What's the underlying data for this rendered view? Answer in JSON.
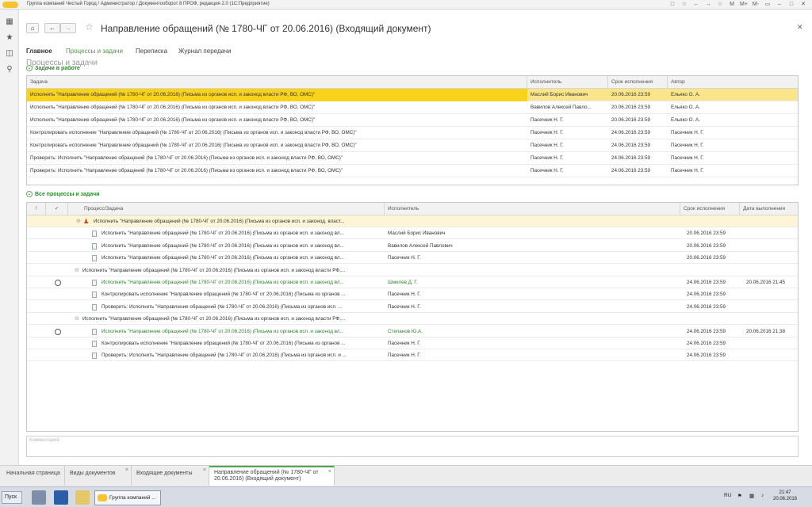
{
  "window": {
    "title": "Группа компаний Чистый Город / Администратор / Документооборот 8 ПРОФ, редакция 2.0  (1С:Предприятие)",
    "controls": [
      "□",
      "☆",
      "←",
      "→",
      "☆",
      "M",
      "M+",
      "M-",
      "▭",
      "–",
      "□",
      "✕"
    ]
  },
  "sidebar": {
    "icons": [
      "apps-icon",
      "star-icon",
      "history-icon",
      "search-icon"
    ]
  },
  "document": {
    "title": "Направление обращений (№ 1780-ЧГ от 20.06.2016) (Входящий документ)"
  },
  "tabs": {
    "main": "Главное",
    "processes": "Процессы и задачи",
    "correspondence": "Переписка",
    "log": "Журнал передачи"
  },
  "section_title": "Процессы и задачи",
  "tasks_in_work": {
    "group_label": "Задачи в работе",
    "columns": [
      "Задача",
      "Исполнитель",
      "Срок исполнения",
      "Автор"
    ],
    "rows": [
      {
        "task": "Исполнить \"Направление обращений (№ 1780-ЧГ от 20.06.2016) (Письма из органов исп. и законод власти РФ, ВО, ОМС)\"",
        "executor": "Маслий Борис Иванович",
        "due": "20.06.2016 23:59",
        "author": "Ельяко О. А."
      },
      {
        "task": "Исполнить \"Направление обращений (№ 1780-ЧГ от 20.06.2016) (Письма из органов исп. и законод власти РФ, ВО, ОМС)\"",
        "executor": "Вавилов Алексей Павло...",
        "due": "20.06.2016 23:59",
        "author": "Ельяко О. А."
      },
      {
        "task": "Исполнить \"Направление обращений (№ 1780-ЧГ от 20.06.2016) (Письма из органов исп. и законод власти РФ, ВО, ОМС)\"",
        "executor": "Пасечник Н. Г.",
        "due": "20.06.2016 23:59",
        "author": "Ельяко О. А."
      },
      {
        "task": "Контролировать исполнение \"Направление обращений (№ 1780-ЧГ от 20.06.2016) (Письма из органов исп. и законод власти РФ, ВО, ОМС)\"",
        "executor": "Пасечник Н. Г.",
        "due": "24.06.2016 23:59",
        "author": "Пасечник Н. Г."
      },
      {
        "task": "Контролировать исполнение \"Направление обращений (№ 1780-ЧГ от 20.06.2016) (Письма из органов исп. и законод власти РФ, ВО, ОМС)\"",
        "executor": "Пасечник Н. Г.",
        "due": "24.06.2016 23:59",
        "author": "Пасечник Н. Г."
      },
      {
        "task": "Проверить: Исполнить \"Направление обращений (№ 1780-ЧГ от 20.06.2016) (Письма из органов исп. и законод власти РФ, ВО, ОМС)\"",
        "executor": "Пасечник Н. Г.",
        "due": "24.06.2016 23:59",
        "author": "Пасечник Н. Г."
      },
      {
        "task": "Проверить: Исполнить \"Направление обращений (№ 1780-ЧГ от 20.06.2016) (Письма из органов исп. и законод власти РФ, ВО, ОМС)\"",
        "executor": "Пасечник Н. Г.",
        "due": "24.06.2016 23:59",
        "author": "Пасечник Н. Г."
      }
    ]
  },
  "all_processes": {
    "group_label": "Все процессы и задачи",
    "columns": [
      "!",
      "✓",
      "Процесс/Задача",
      "Исполнитель",
      "Срок исполнения",
      "Дата выполнения"
    ],
    "rows": [
      {
        "level": 1,
        "icon": "user",
        "text": "Исполнить \"Направление обращений (№ 1780-ЧГ от 20.06.2016) (Письма из органов исп. и законод. власт...",
        "executor": "",
        "due": "",
        "done_date": "",
        "check": false
      },
      {
        "level": 2,
        "icon": "doc",
        "text": "Исполнить \"Направление обращений (№ 1780-ЧГ от 20.06.2016) (Письма из органов исп. и законод вл...",
        "executor": "Маслий Борис Иванович",
        "due": "20.06.2016 23:59",
        "done_date": "",
        "check": false
      },
      {
        "level": 2,
        "icon": "doc",
        "text": "Исполнить \"Направление обращений (№ 1780-ЧГ от 20.06.2016) (Письма из органов исп. и законод вл...",
        "executor": "Вавилов Алексей Павлович",
        "due": "20.06.2016 23:59",
        "done_date": "",
        "check": false
      },
      {
        "level": 2,
        "icon": "doc",
        "text": "Исполнить \"Направление обращений (№ 1780-ЧГ от 20.06.2016) (Письма из органов исп. и законод вл...",
        "executor": "Пасечник Н. Г.",
        "due": "20.06.2016 23:59",
        "done_date": "",
        "check": false
      },
      {
        "level": 0,
        "icon": "none",
        "text": "Исполнить \"Направление обращений (№ 1780-ЧГ от 20.06.2016) (Письма из органов исп. и законод власти РФ,...",
        "executor": "",
        "due": "",
        "done_date": "",
        "check": false
      },
      {
        "level": 2,
        "icon": "doc",
        "text": "Исполнить \"Направление обращений (№ 1780-ЧГ от 20.06.2016) (Письма из органов исп. и законод вл...",
        "executor": "Шмелев Д. Г.",
        "due": "24.06.2016 23:59",
        "done_date": "20.06.2016 21:45",
        "check": true,
        "green": true
      },
      {
        "level": 2,
        "icon": "doc",
        "text": "Контролировать исполнение \"Направление обращений (№ 1780-ЧГ от 20.06.2016) (Письма из органов ...",
        "executor": "Пасечник Н. Г.",
        "due": "24.06.2016 23:59",
        "done_date": "",
        "check": false
      },
      {
        "level": 2,
        "icon": "doc",
        "text": "Проверить: Исполнить \"Направление обращений (№ 1780-ЧГ от 20.06.2016) (Письма из органов исп. ...",
        "executor": "Пасечник Н. Г.",
        "due": "24.06.2016 23:59",
        "done_date": "",
        "check": false
      },
      {
        "level": 0,
        "icon": "none",
        "text": "Исполнить \"Направление обращений (№ 1780-ЧГ от 20.06.2016) (Письма из органов исп. и законод власти РФ,...",
        "executor": "",
        "due": "",
        "done_date": "",
        "check": false
      },
      {
        "level": 2,
        "icon": "doc",
        "text": "Исполнить \"Направление обращений (№ 1780-ЧГ от 20.06.2016) (Письма из органов исп. и законод вл...",
        "executor": "Степанов Ю.А.",
        "due": "24.06.2016 23:59",
        "done_date": "20.06.2016 21:38",
        "check": true,
        "green": true
      },
      {
        "level": 2,
        "icon": "doc",
        "text": "Контролировать исполнение \"Направление обращений (№ 1780-ЧГ от 20.06.2016) (Письма из органов ...",
        "executor": "Пасечник Н. Г.",
        "due": "24.06.2016 23:59",
        "done_date": "",
        "check": false
      },
      {
        "level": 2,
        "icon": "doc",
        "text": "Проверить: Исполнить \"Направление обращений (№ 1780-ЧГ от 20.06.2016) (Письма из органов исп. и ...",
        "executor": "Пасечник Н. Г.",
        "due": "24.06.2016 23:59",
        "done_date": "",
        "check": false
      }
    ]
  },
  "comment": {
    "placeholder": "Комментарий"
  },
  "bottom_tabs": [
    {
      "label": "Начальная страница",
      "closable": false
    },
    {
      "label": "Виды документов",
      "closable": true
    },
    {
      "label": "Входящие документы",
      "closable": true
    },
    {
      "label": "Направление обращений (№ 1780-ЧГ от 20.06.2016) (Входящий документ)",
      "closable": true,
      "active": true
    }
  ],
  "taskbar": {
    "start": "Пуск",
    "app_label": "Группа компаний ...",
    "lang": "RU",
    "time": "21:47",
    "date": "20.06.2016"
  },
  "colors": {
    "accent_green": "#4fa74f",
    "selection_yellow": "#f8d21b",
    "selection_row": "#fbe58a",
    "link_green": "#4e9a40"
  }
}
